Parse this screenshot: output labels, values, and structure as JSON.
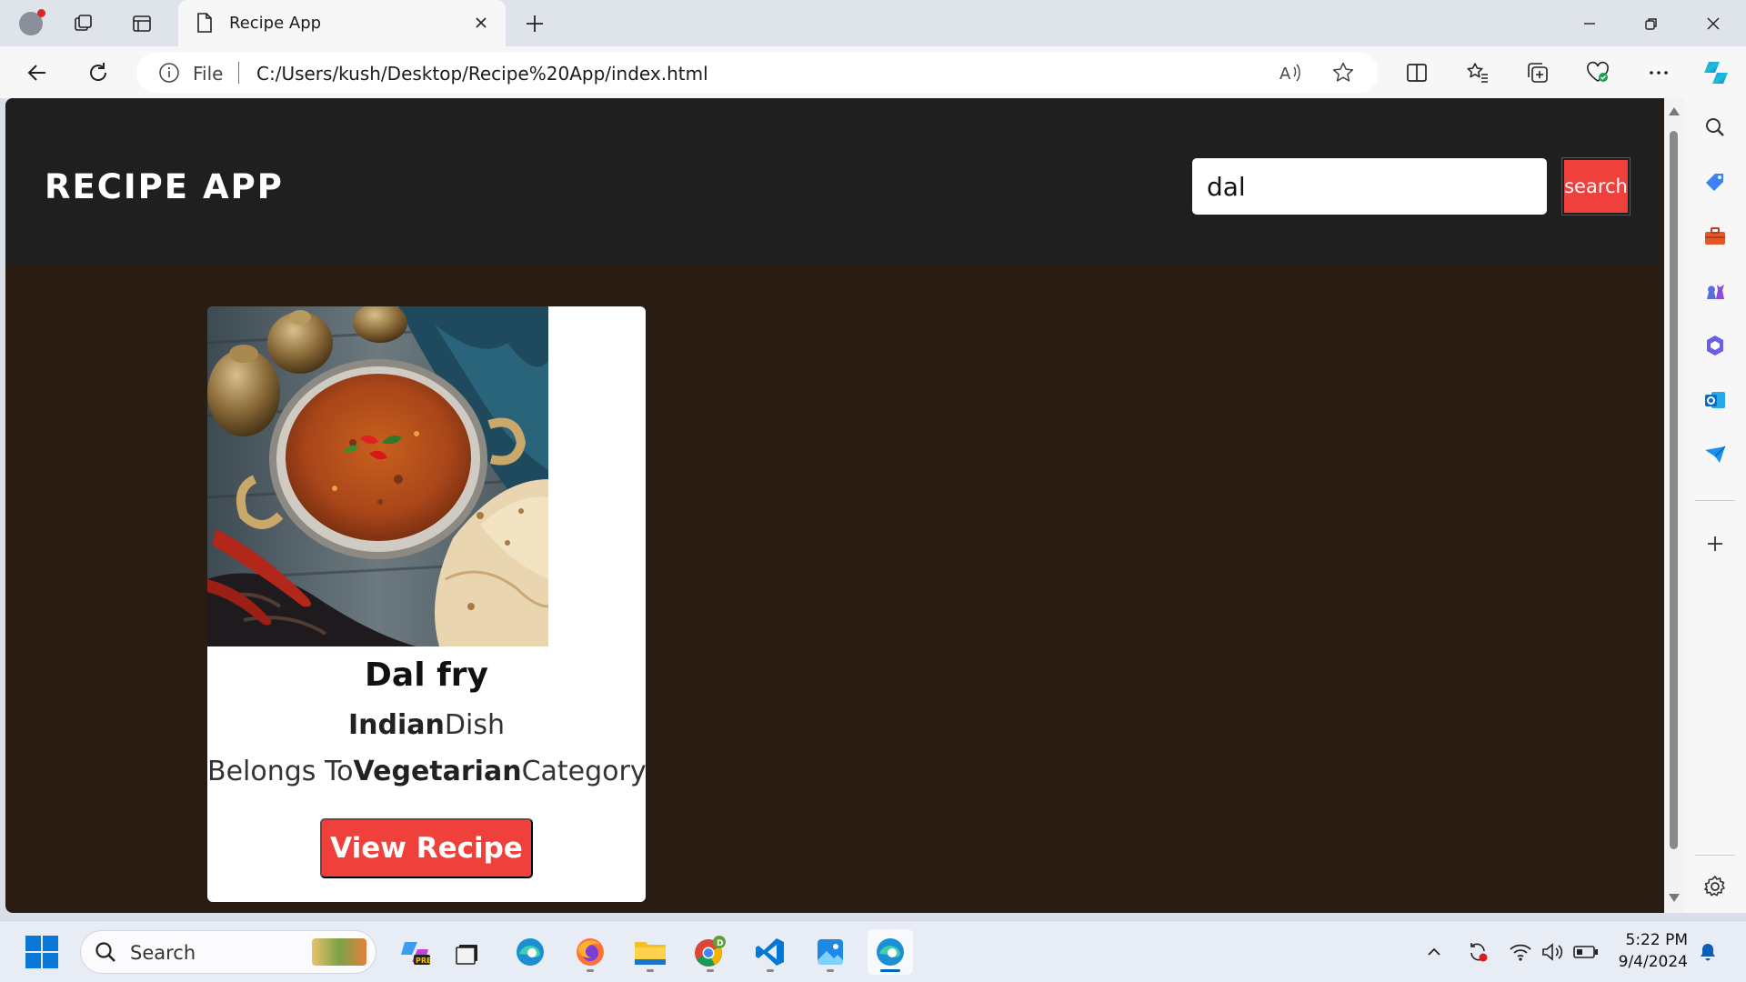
{
  "browser": {
    "tab_title": "Recipe App",
    "address_prefix": "File",
    "url": "C:/Users/kush/Desktop/Recipe%20App/index.html"
  },
  "app": {
    "title": "RECIPE APP",
    "search_value": "dal",
    "search_button": "search"
  },
  "recipe": {
    "name": "Dal fry",
    "area": "Indian",
    "area_suffix": "Dish",
    "category_prefix": "Belongs To",
    "category": "Vegetarian",
    "category_suffix": "Category",
    "view_button": "View Recipe"
  },
  "taskbar": {
    "search_label": "Search",
    "time": "5:22 PM",
    "date": "9/4/2024"
  },
  "icons": {
    "title_bar": [
      "profile-avatar-icon",
      "workspaces-icon",
      "tab-actions-icon",
      "page-icon",
      "close-icon",
      "plus-icon",
      "minimize-icon",
      "restore-icon",
      "window-close-icon"
    ],
    "toolbar": [
      "back-icon",
      "refresh-icon",
      "info-icon",
      "read-aloud-icon",
      "favorite-star-icon",
      "split-screen-icon",
      "favorites-icon",
      "collections-icon",
      "browser-essentials-icon",
      "more-icon",
      "copilot-icon"
    ],
    "sidebar": [
      "search-icon",
      "shopping-icon",
      "tools-icon",
      "games-icon",
      "office-icon",
      "outlook-icon",
      "send-icon",
      "add-icon",
      "settings-icon"
    ],
    "taskbar_apps": [
      "copilot-pre-icon",
      "task-view-icon",
      "edge-icon",
      "firefox-icon",
      "file-explorer-icon",
      "chrome-icon",
      "vscode-icon",
      "photos-icon",
      "edge-active-icon"
    ]
  },
  "colors": {
    "page_background": "#291d13",
    "header_background": "#1f1f1f",
    "accent_red": "#f0403c",
    "card_background": "#ffffff"
  }
}
